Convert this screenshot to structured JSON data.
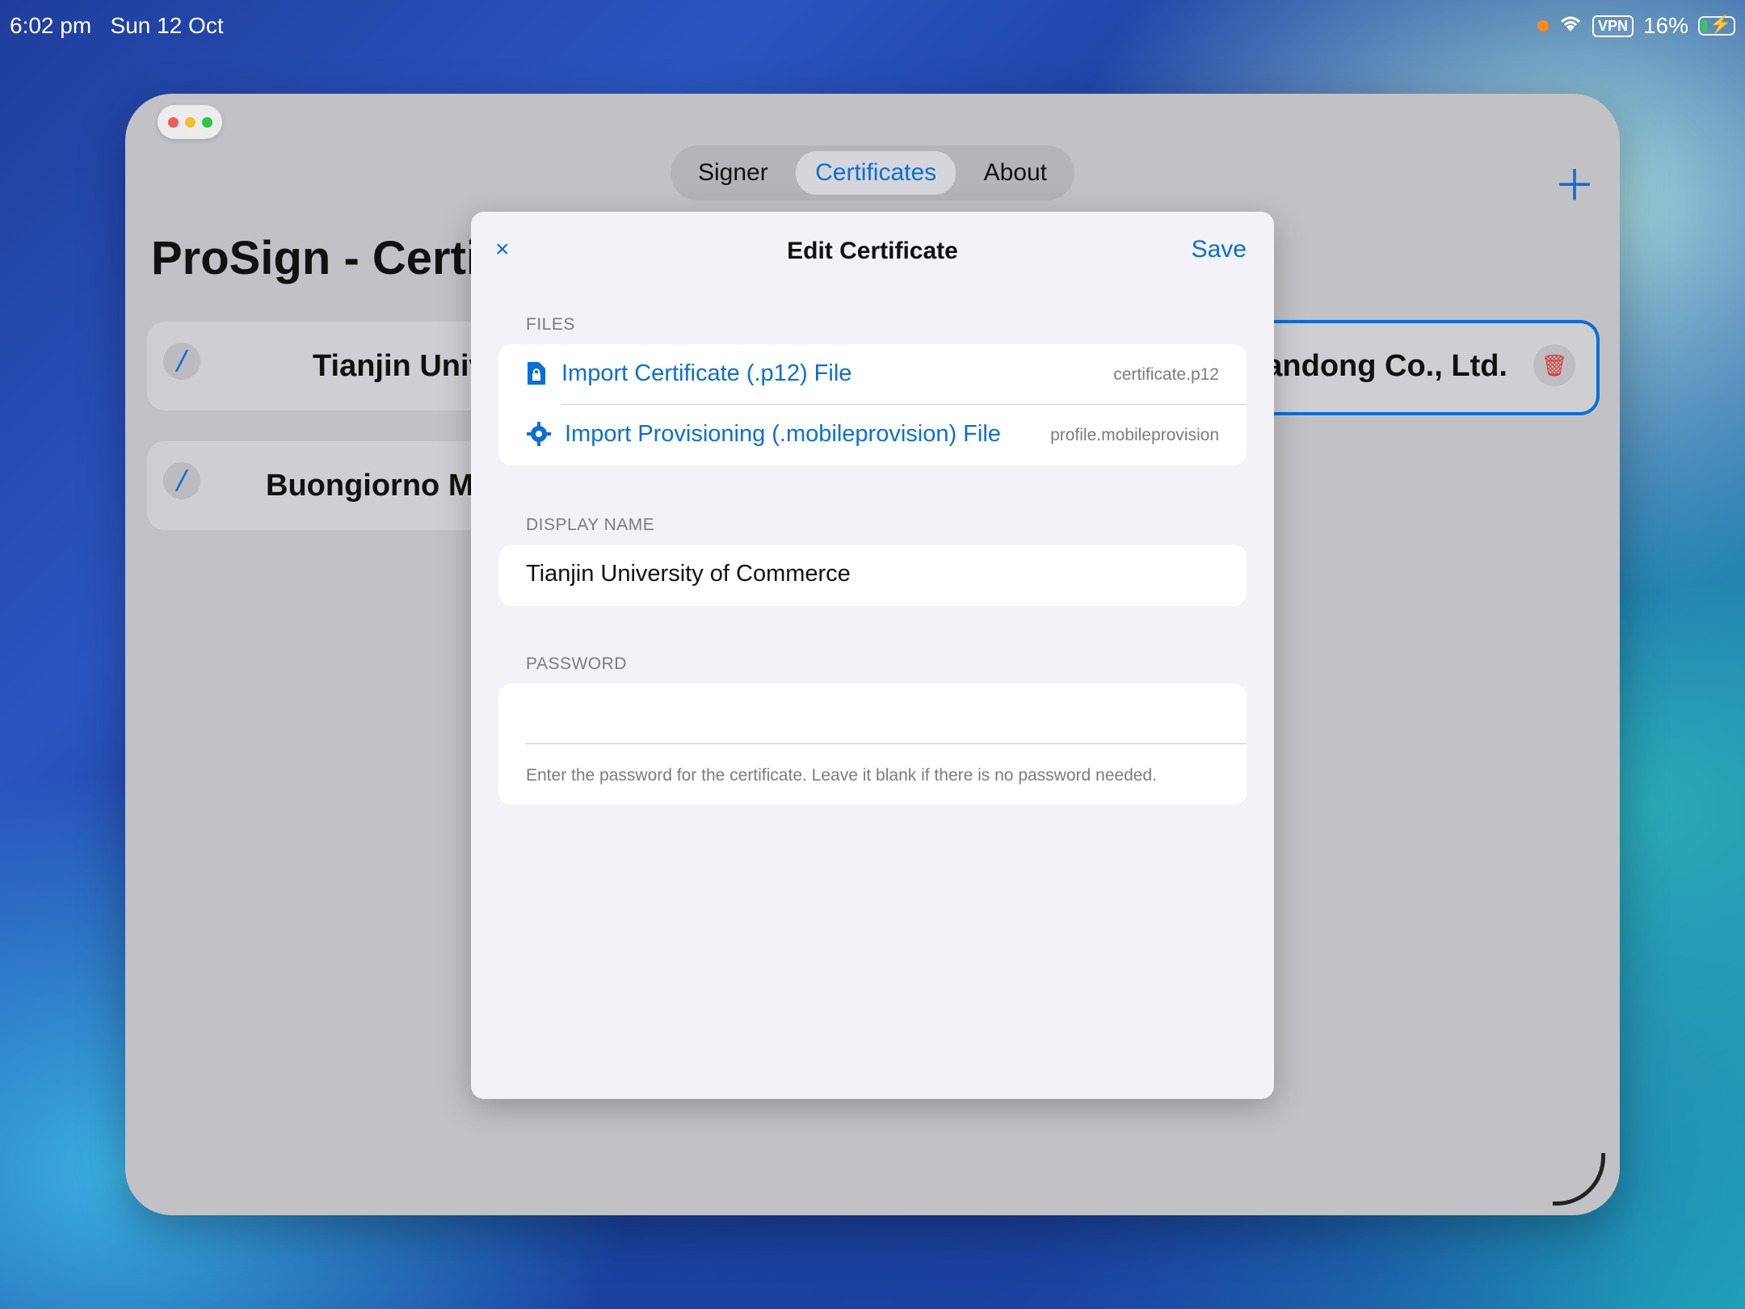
{
  "status_bar": {
    "time": "6:02 pm",
    "date": "Sun 12 Oct",
    "vpn": "VPN",
    "battery": "16%",
    "battery_level": 0.16
  },
  "app": {
    "tabs": [
      {
        "label": "Signer"
      },
      {
        "label": "Certificates",
        "active": true
      },
      {
        "label": "About"
      }
    ],
    "page_title": "ProSign - Certi",
    "rows": [
      {
        "name_visible": "Tianjin Univer",
        "right_name": "handong Co., Ltd."
      },
      {
        "name_visible": "Buongiorno Man"
      }
    ]
  },
  "modal": {
    "close_glyph": "×",
    "title": "Edit Certificate",
    "save": "Save",
    "files_label": "FILES",
    "files": [
      {
        "label": "Import Certificate (.p12) File",
        "value": "certificate.p12",
        "icon": "document-lock-icon"
      },
      {
        "label": "Import Provisioning (.mobileprovision) File",
        "value": "profile.mobileprovision",
        "icon": "gear-icon"
      }
    ],
    "display_name_label": "DISPLAY NAME",
    "display_name_value": "Tianjin University of Commerce",
    "password_label": "PASSWORD",
    "password_value": "",
    "password_note": "Enter the password for the certificate. Leave it blank if there is no password needed."
  },
  "colors": {
    "accent": "#0a6fd6",
    "destructive": "#d83a3a"
  }
}
